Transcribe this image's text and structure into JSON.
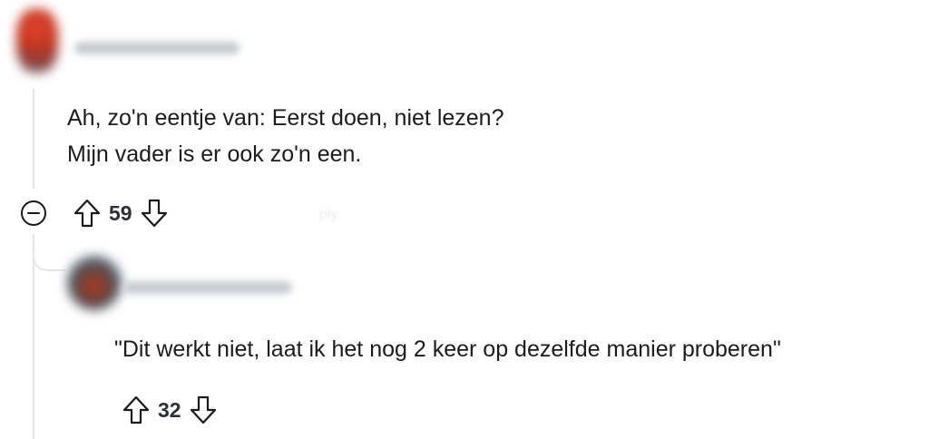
{
  "comment": {
    "author": "",
    "text_line_1": "Ah, zo'n eentje van: Eerst doen, niet lezen?",
    "text_line_2": "Mijn vader is er ook zo'n een.",
    "score": "59",
    "faint_action": "ply"
  },
  "reply": {
    "author": "",
    "text": "\"Dit werkt niet, laat ik het nog 2 keer op dezelfde manier proberen\"",
    "score": "32"
  },
  "icons": {
    "upvote": "arrow-up-outline-icon",
    "downvote": "arrow-down-outline-icon",
    "collapse": "minus-circle-icon"
  },
  "colors": {
    "thread_line": "#e4e7ea",
    "text": "#1c1c1c",
    "icon": "#1a1a1b"
  }
}
